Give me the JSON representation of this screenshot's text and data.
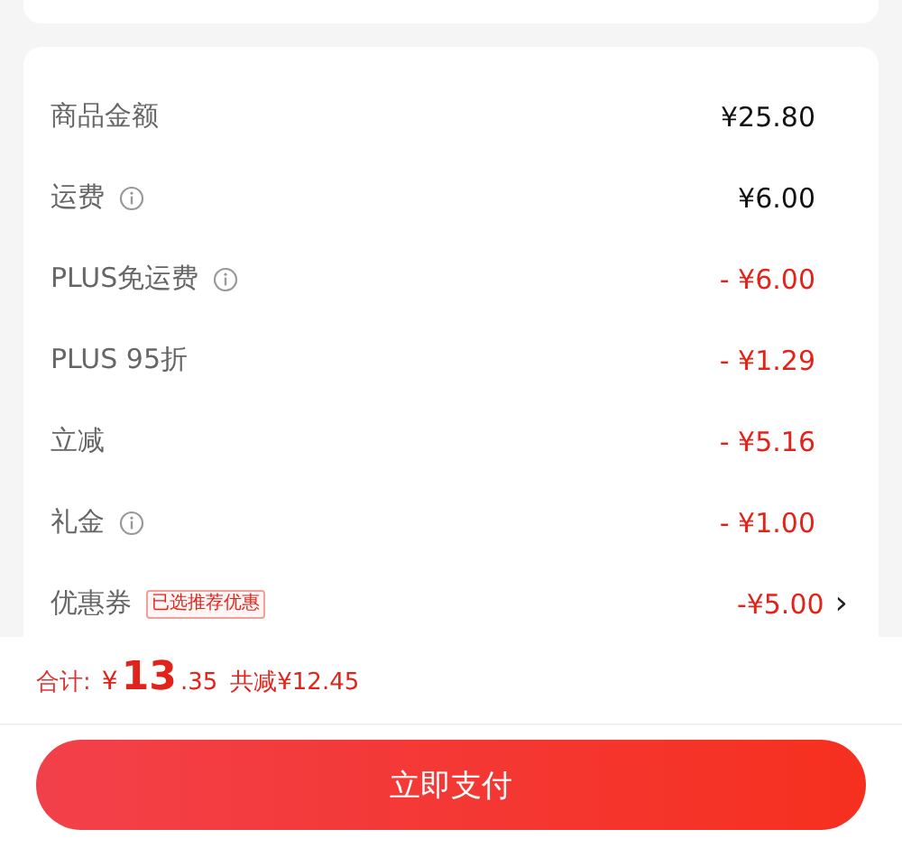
{
  "fees": [
    {
      "label": "商品金额",
      "info": false,
      "amount": "¥25.80",
      "discount": false
    },
    {
      "label": "运费",
      "info": true,
      "amount": "¥6.00",
      "discount": false
    },
    {
      "label": "PLUS免运费",
      "info": true,
      "amount": "- ¥6.00",
      "discount": true
    },
    {
      "label": "PLUS 95折",
      "info": false,
      "amount": "- ¥1.29",
      "discount": true
    },
    {
      "label": "立减",
      "info": false,
      "amount": "- ¥5.16",
      "discount": true
    },
    {
      "label": "礼金",
      "info": true,
      "amount": "- ¥1.00",
      "discount": true
    },
    {
      "label": "优惠券",
      "info": false,
      "tag": "已选推荐优惠",
      "amount": "-¥5.00",
      "discount": true,
      "chevron": "›"
    }
  ],
  "total": {
    "label": "合计:",
    "currency": "¥",
    "integer": "13",
    "decimal": ".35",
    "saving": "共减¥12.45"
  },
  "pay_button": "立即支付"
}
